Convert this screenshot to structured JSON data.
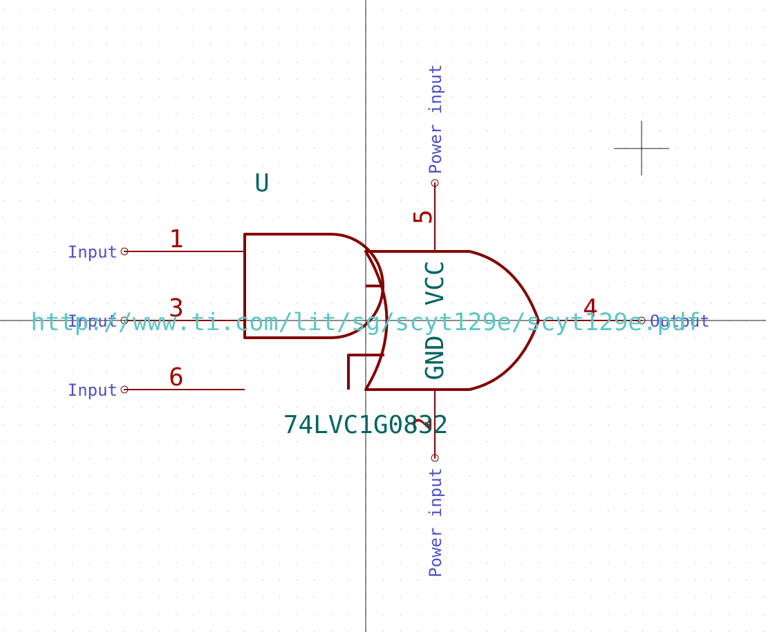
{
  "colors": {
    "background": "#ffffff",
    "grid": "#bdbdbd",
    "axis": "#1a1a1a",
    "body": "#840000",
    "pin_number": "#a00000",
    "pin_type": "#5050c8",
    "field": "#006464",
    "datasheet": "#5cc6c6"
  },
  "symbol": {
    "reference": "U",
    "value": "74LVC1G0832",
    "datasheet": "http://www.ti.com/lit/sg/scyt129e/scyt129e.pdf"
  },
  "pins": [
    {
      "number": "1",
      "type": "Input"
    },
    {
      "number": "3",
      "type": "Input"
    },
    {
      "number": "6",
      "type": "Input"
    },
    {
      "number": "4",
      "type": "Output"
    },
    {
      "number": "5",
      "type": "Power input",
      "name": "VCC"
    },
    {
      "number": "2",
      "type": "Power input",
      "name": "GND"
    }
  ]
}
